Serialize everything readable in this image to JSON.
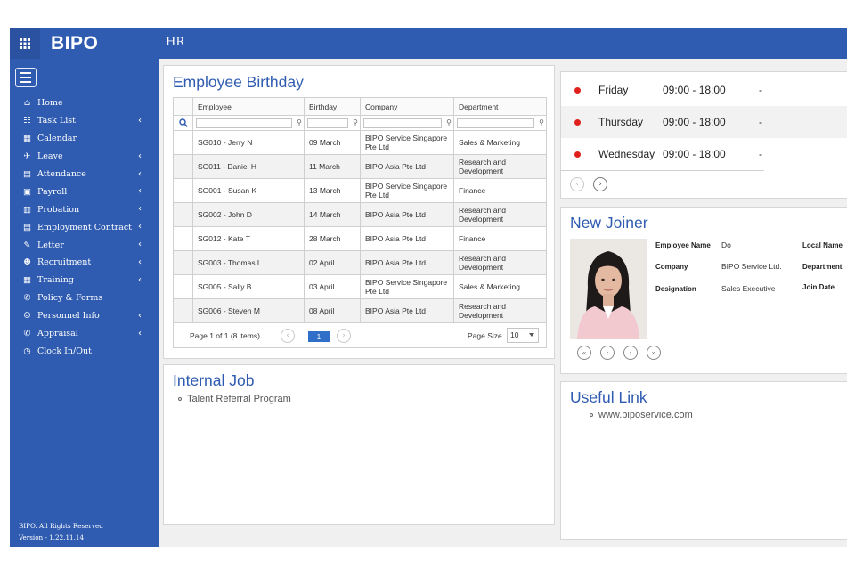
{
  "brand": "BIPO",
  "module_title": "HR",
  "sidebar": {
    "items": [
      {
        "label": "Home",
        "icon": "home-icon",
        "has_submenu": false
      },
      {
        "label": "Task List",
        "icon": "task-list-icon",
        "has_submenu": true
      },
      {
        "label": "Calendar",
        "icon": "calendar-icon",
        "has_submenu": false
      },
      {
        "label": "Leave",
        "icon": "plane-icon",
        "has_submenu": true
      },
      {
        "label": "Attendance",
        "icon": "attendance-icon",
        "has_submenu": true
      },
      {
        "label": "Payroll",
        "icon": "payroll-icon",
        "has_submenu": true
      },
      {
        "label": "Probation",
        "icon": "probation-icon",
        "has_submenu": true
      },
      {
        "label": "Employment Contract",
        "icon": "contract-icon",
        "has_submenu": true
      },
      {
        "label": "Letter",
        "icon": "letter-icon",
        "has_submenu": true
      },
      {
        "label": "Recruitment",
        "icon": "recruitment-icon",
        "has_submenu": true
      },
      {
        "label": "Training",
        "icon": "training-icon",
        "has_submenu": true
      },
      {
        "label": "Policy & Forms",
        "icon": "policy-icon",
        "has_submenu": false
      },
      {
        "label": "Personnel Info",
        "icon": "personnel-icon",
        "has_submenu": true
      },
      {
        "label": "Appraisal",
        "icon": "appraisal-icon",
        "has_submenu": true
      },
      {
        "label": "Clock In/Out",
        "icon": "clock-icon",
        "has_submenu": false
      }
    ],
    "footer_copyright": "BIPO. All Rights Reserved",
    "footer_version": "Version - 1.22.11.14"
  },
  "birthday": {
    "title": "Employee Birthday",
    "columns": [
      "Employee",
      "Birthday",
      "Company",
      "Department"
    ],
    "rows": [
      [
        "SG010 - Jerry N",
        "09 March",
        "BIPO Service Singapore Pte Ltd",
        "Sales & Marketing"
      ],
      [
        "SG011 - Daniel H",
        "11 March",
        "BIPO Asia Pte Ltd",
        "Research and Development"
      ],
      [
        "SG001 - Susan K",
        "13 March",
        "BIPO Service Singapore Pte Ltd",
        "Finance"
      ],
      [
        "SG002 - John D",
        "14 March",
        "BIPO Asia Pte Ltd",
        "Research and Development"
      ],
      [
        "SG012 - Kate T",
        "28 March",
        "BIPO Asia Pte Ltd",
        "Finance"
      ],
      [
        "SG003 - Thomas L",
        "02 April",
        "BIPO Asia Pte Ltd",
        "Research and Development"
      ],
      [
        "SG005 - Sally B",
        "03 April",
        "BIPO Service Singapore Pte Ltd",
        "Sales & Marketing"
      ],
      [
        "SG006 - Steven M",
        "08 April",
        "BIPO Asia Pte Ltd",
        "Research and Development"
      ]
    ],
    "page_info": "Page 1 of 1 (8 items)",
    "current_page": "1",
    "page_size_label": "Page Size",
    "page_size": "10"
  },
  "internal_job": {
    "title": "Internal Job",
    "items": [
      "Talent Referral Program"
    ]
  },
  "schedule": {
    "rows": [
      {
        "day": "Friday",
        "time": "09:00 - 18:00",
        "note": "-"
      },
      {
        "day": "Thursday",
        "time": "09:00 - 18:00",
        "note": "-"
      },
      {
        "day": "Wednesday",
        "time": "09:00 - 18:00",
        "note": "-"
      }
    ],
    "dot_color": "#e0201a"
  },
  "new_joiner": {
    "title": "New Joiner",
    "fields": {
      "employee_name_label": "Employee Name",
      "employee_name_value": "Do",
      "local_name_label": "Local Name",
      "company_label": "Company",
      "company_value": "BIPO Service Ltd.",
      "department_label": "Department",
      "designation_label": "Designation",
      "designation_value": "Sales Executive",
      "join_date_label": "Join Date"
    }
  },
  "useful_link": {
    "title": "Useful Link",
    "items": [
      "www.biposervice.com"
    ]
  },
  "colors": {
    "primary": "#2f5cb1",
    "title_blue": "#2f5cb1",
    "page_active": "#2f6fc7"
  }
}
